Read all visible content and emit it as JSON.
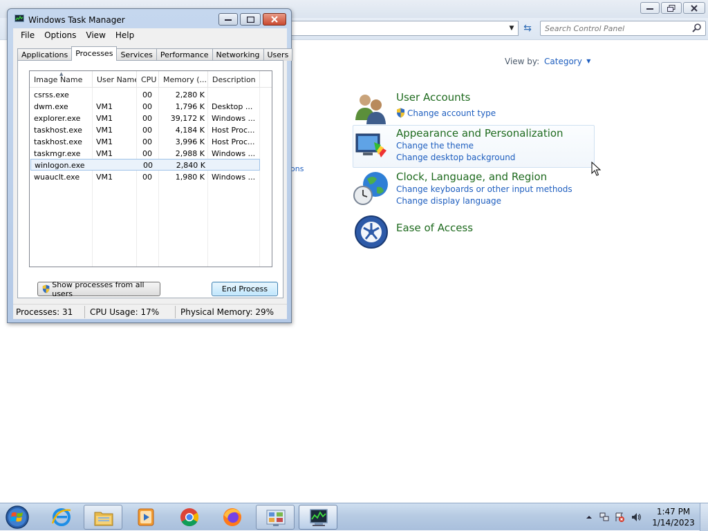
{
  "control_panel": {
    "search": {
      "placeholder": "Search Control Panel"
    },
    "view_by": {
      "label": "View by:",
      "value": "Category"
    },
    "categories": [
      {
        "title": "User Accounts",
        "links": [
          "Change account type"
        ]
      },
      {
        "title": "Appearance and Personalization",
        "links": [
          "Change the theme",
          "Change desktop background"
        ]
      },
      {
        "title": "Clock, Language, and Region",
        "links": [
          "Change keyboards or other input methods",
          "Change display language"
        ]
      },
      {
        "title": "Ease of Access",
        "links": []
      }
    ],
    "partial_text": "ons"
  },
  "task_manager": {
    "title": "Windows Task Manager",
    "menu": [
      "File",
      "Options",
      "View",
      "Help"
    ],
    "tabs": [
      "Applications",
      "Processes",
      "Services",
      "Performance",
      "Networking",
      "Users"
    ],
    "active_tab": "Processes",
    "columns": [
      "Image Name",
      "User Name",
      "CPU",
      "Memory (...",
      "Description"
    ],
    "processes": [
      {
        "name": "csrss.exe",
        "user": "",
        "cpu": "00",
        "memory": "2,280 K",
        "description": ""
      },
      {
        "name": "dwm.exe",
        "user": "VM1",
        "cpu": "00",
        "memory": "1,796 K",
        "description": "Desktop ..."
      },
      {
        "name": "explorer.exe",
        "user": "VM1",
        "cpu": "00",
        "memory": "39,172 K",
        "description": "Windows ..."
      },
      {
        "name": "taskhost.exe",
        "user": "VM1",
        "cpu": "00",
        "memory": "4,184 K",
        "description": "Host Proc..."
      },
      {
        "name": "taskhost.exe",
        "user": "VM1",
        "cpu": "00",
        "memory": "3,996 K",
        "description": "Host Proc..."
      },
      {
        "name": "taskmgr.exe",
        "user": "VM1",
        "cpu": "00",
        "memory": "2,988 K",
        "description": "Windows ..."
      },
      {
        "name": "winlogon.exe",
        "user": "",
        "cpu": "00",
        "memory": "2,840 K",
        "description": ""
      },
      {
        "name": "wuauclt.exe",
        "user": "VM1",
        "cpu": "00",
        "memory": "1,980 K",
        "description": "Windows ..."
      }
    ],
    "selected_process": "winlogon.exe",
    "buttons": {
      "show_all": "Show processes from all users",
      "end_process": "End Process"
    },
    "status": {
      "processes": "Processes: 31",
      "cpu": "CPU Usage: 17%",
      "memory": "Physical Memory: 29%"
    }
  },
  "taskbar": {
    "apps": [
      {
        "name": "internet-explorer-icon"
      },
      {
        "name": "windows-explorer-icon"
      },
      {
        "name": "media-player-icon"
      },
      {
        "name": "chrome-icon"
      },
      {
        "name": "firefox-icon"
      },
      {
        "name": "control-panel-icon"
      },
      {
        "name": "task-manager-icon"
      }
    ],
    "clock": {
      "time": "1:47 PM",
      "date": "1/14/2023"
    }
  }
}
